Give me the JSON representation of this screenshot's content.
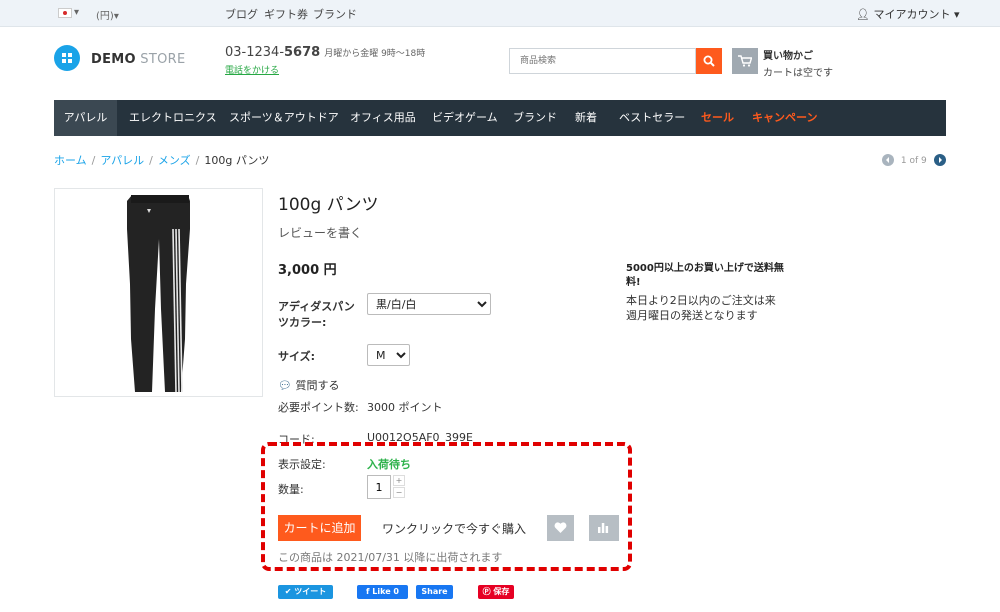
{
  "topbar": {
    "currency": "(円)",
    "nav": [
      "ブログ",
      "ギフト券",
      "ブランド"
    ],
    "account": "マイアカウント"
  },
  "header": {
    "logo_bold": "DEMO",
    "logo_light": "STORE",
    "phone_prefix": "03-1234-",
    "phone_bold": "5678",
    "hours": "月曜から金曜 9時～18時",
    "callback": "電話をかける",
    "search_placeholder": "商品検索",
    "cart_title": "買い物かご",
    "cart_status": "カートは空です"
  },
  "menu": [
    {
      "label": "アパレル",
      "active": true
    },
    {
      "label": "エレクトロニクス"
    },
    {
      "label": "スポーツ＆アウトドア"
    },
    {
      "label": "オフィス用品"
    },
    {
      "label": "ビデオゲーム"
    },
    {
      "label": "ブランド"
    },
    {
      "label": "新着"
    },
    {
      "label": "ベストセラー"
    },
    {
      "label": "セール",
      "hot": true
    },
    {
      "label": "キャンペーン",
      "hot": true
    }
  ],
  "breadcrumb": [
    "ホーム",
    "アパレル",
    "メンズ",
    "100g パンツ"
  ],
  "pager": "1 of 9",
  "product": {
    "title": "100g パンツ",
    "review_link": "レビューを書く",
    "price": "3,000 円",
    "color_label_line1": "アディダスパン",
    "color_label_line2": "ツカラー:",
    "color_value": "黒/白/白",
    "size_label": "サイズ:",
    "size_value": "M",
    "ask_link": "質問する",
    "points_label": "必要ポイント数:",
    "points_value": "3000 ポイント",
    "code_label": "コード:",
    "code_value": "U0012O5AF0_399E",
    "display_label": "表示設定:",
    "display_value": "入荷待ち",
    "qty_label": "数量:",
    "qty_value": "1",
    "add_to_cart": "カートに追加",
    "one_click": "ワンクリックで今すぐ購入",
    "ship_note": "この商品は 2021/07/31 以降に出荷されます"
  },
  "promo": {
    "title": "5000円以上のお買い上げで送料無料!",
    "body": "本日より2日以内のご注文は来週月曜日の発送となります"
  },
  "social": {
    "tweet": "ツイート",
    "like": "Like 0",
    "share": "Share",
    "save": "保存"
  },
  "colors": {
    "accent": "#fe5a1d",
    "menu_bg": "#26333d",
    "link": "#1aa3e8",
    "status_green": "#2db24b",
    "highlight": "#e00000"
  }
}
